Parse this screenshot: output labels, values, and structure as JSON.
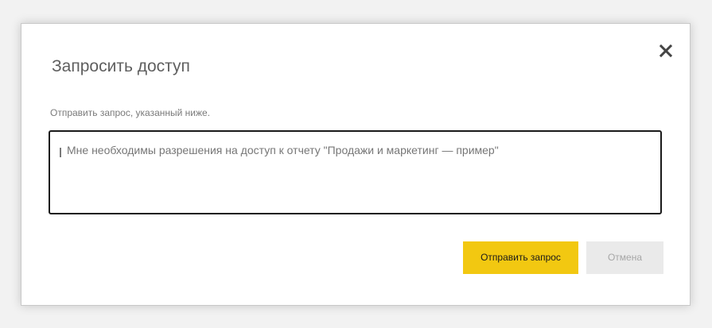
{
  "dialog": {
    "title": "Запросить доступ",
    "subtitle": "Отправить запрос, указанный ниже.",
    "message_value": "Мне необходимы разрешения на доступ к отчету \"Продажи и маркетинг — пример\"",
    "send_label": "Отправить запрос",
    "cancel_label": "Отмена",
    "close_icon": "close-icon"
  },
  "colors": {
    "primary_button": "#f2c811",
    "secondary_button": "#eaeaea"
  }
}
